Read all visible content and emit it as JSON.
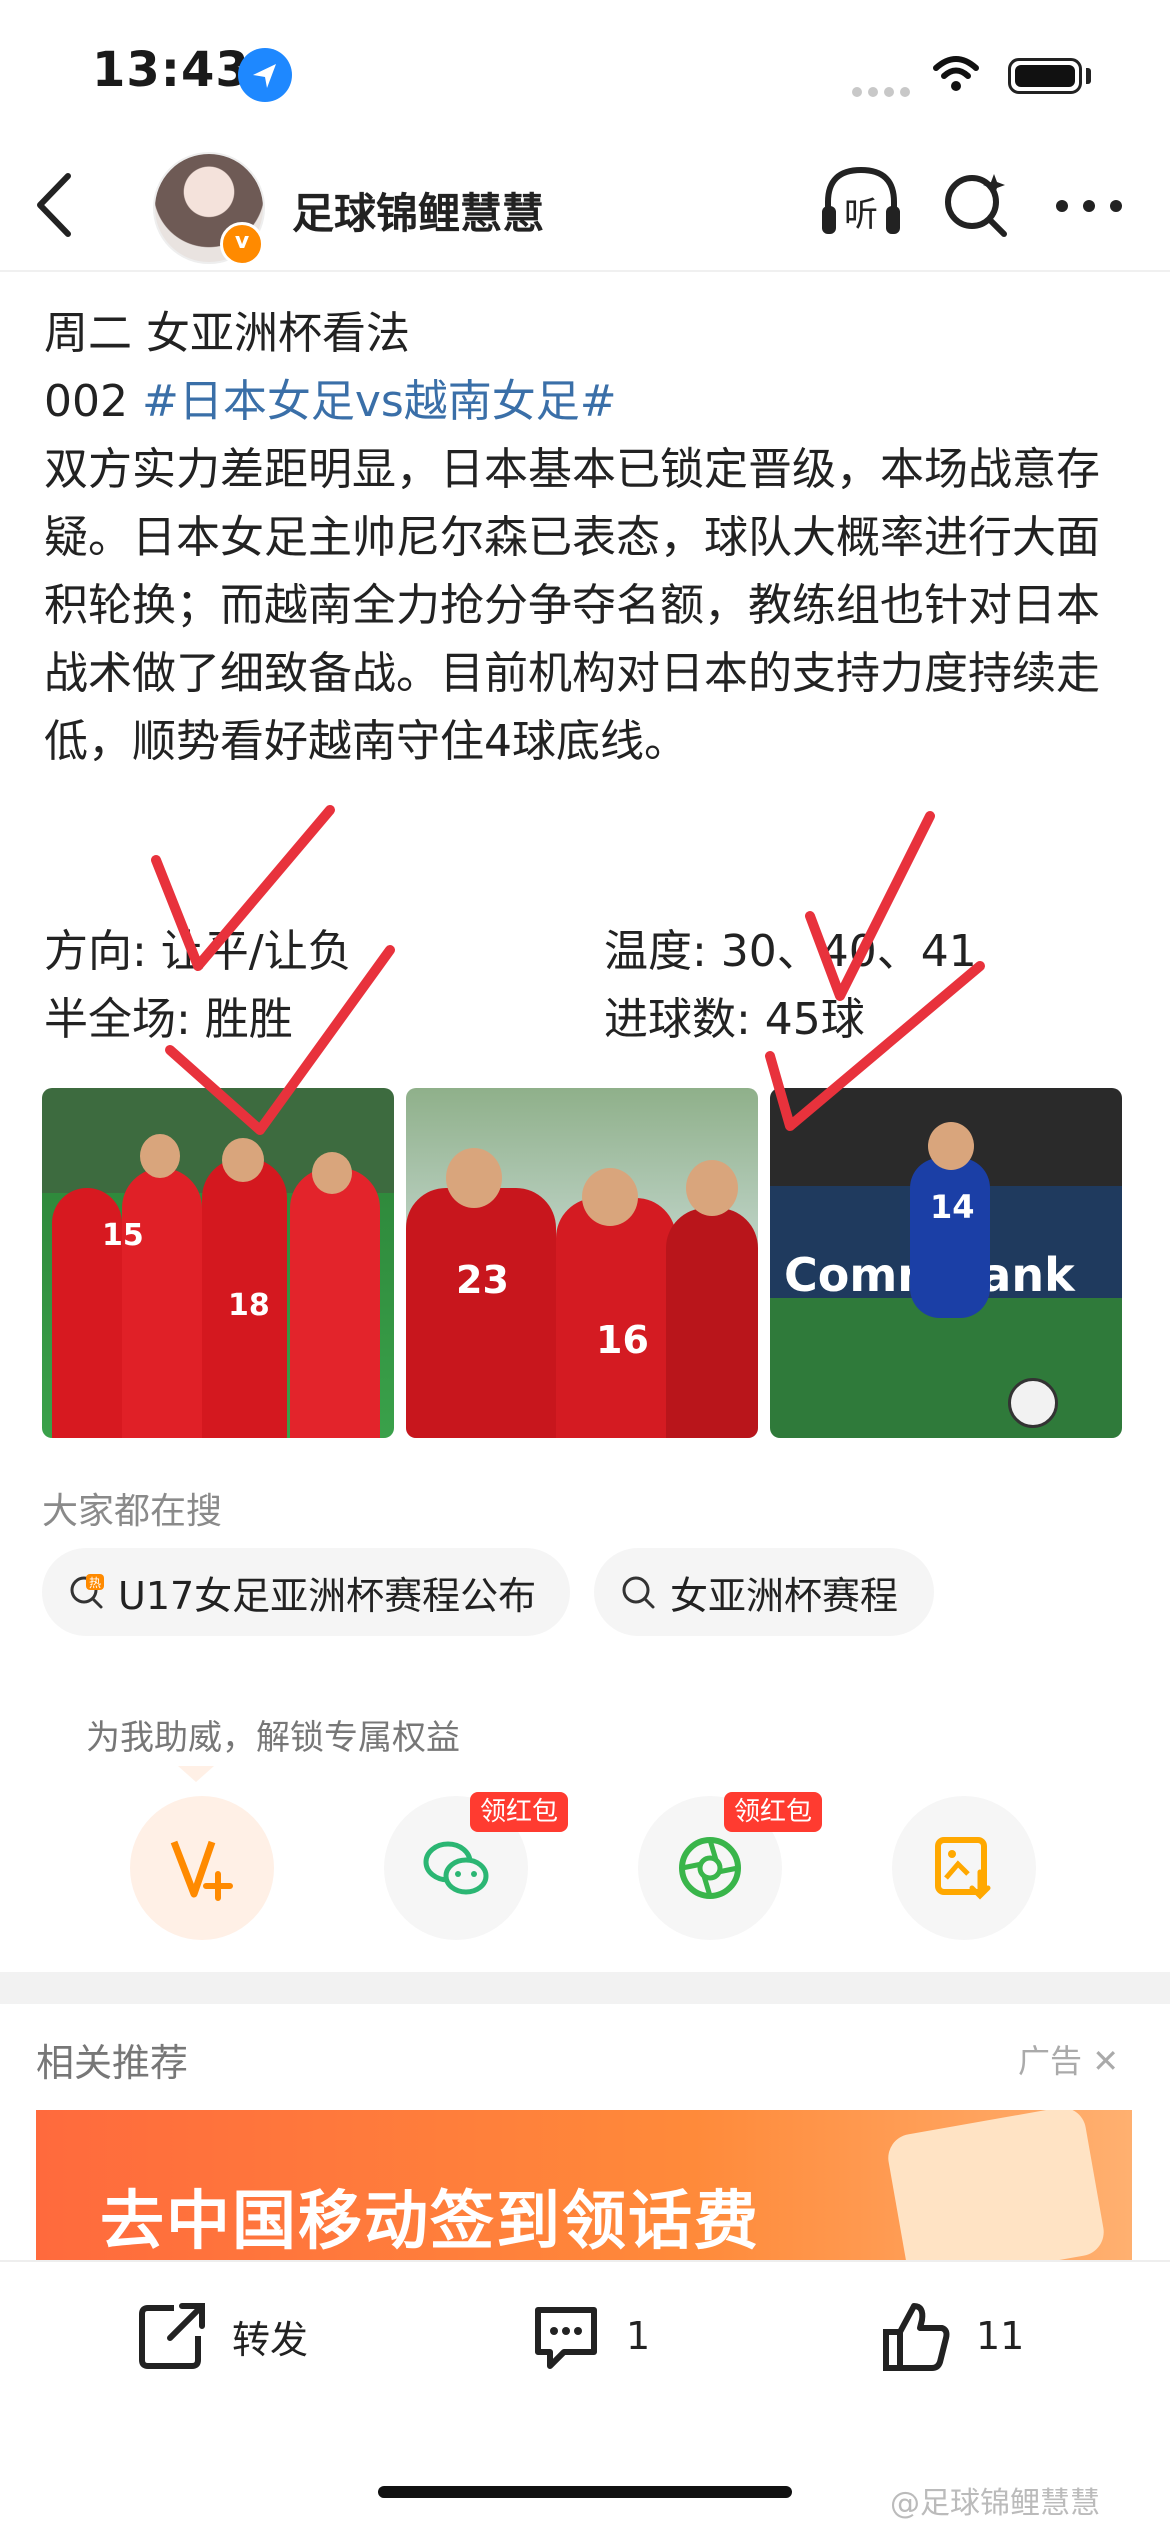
{
  "status_bar": {
    "time": "13:43"
  },
  "header": {
    "username": "足球锦鲤慧慧",
    "listen_label": "听"
  },
  "post": {
    "line1": "周二 女亚洲杯看法",
    "line2_prefix": "002 ",
    "line2_hashtag": "#日本女足vs越南女足#",
    "body": "双方实力差距明显，日本基本已锁定晋级，本场战意存疑。日本女足主帅尼尔森已表态，球队大概率进行大面积轮换；而越南全力抢分争夺名额，教练组也针对日本战术做了细致备战。目前机构对日本的支持力度持续走低，顺势看好越南守住4球底线。",
    "direction": "方向: 让平/让负",
    "temperature": "温度: 30、40、41",
    "half_full": "半全场: 胜胜",
    "goals": "进球数: 45球"
  },
  "photos": {
    "p1_numbers": [
      "15",
      "18"
    ],
    "p2_numbers": [
      "23",
      "16"
    ],
    "p3_number": "14",
    "p3_board": "CommBank"
  },
  "search_section": {
    "label": "大家都在搜",
    "pills": [
      {
        "badge": "热",
        "text": "U17女足亚洲杯赛程公布"
      },
      {
        "text": "女亚洲杯赛程"
      }
    ]
  },
  "support": {
    "label": "为我助威，解锁专属权益",
    "badges": [
      "领红包",
      "领红包"
    ]
  },
  "recommend": {
    "title": "相关推荐",
    "ad_tag": "广告",
    "banner_text": "去中国移动签到领话费"
  },
  "bottom_bar": {
    "repost_label": "转发",
    "comment_count": "1",
    "like_count": "11"
  },
  "watermark": "@足球锦鲤慧慧",
  "colors": {
    "hashtag": "#3a6fa8",
    "badge_red": "#ff3b30",
    "check_red": "#e8323c"
  }
}
